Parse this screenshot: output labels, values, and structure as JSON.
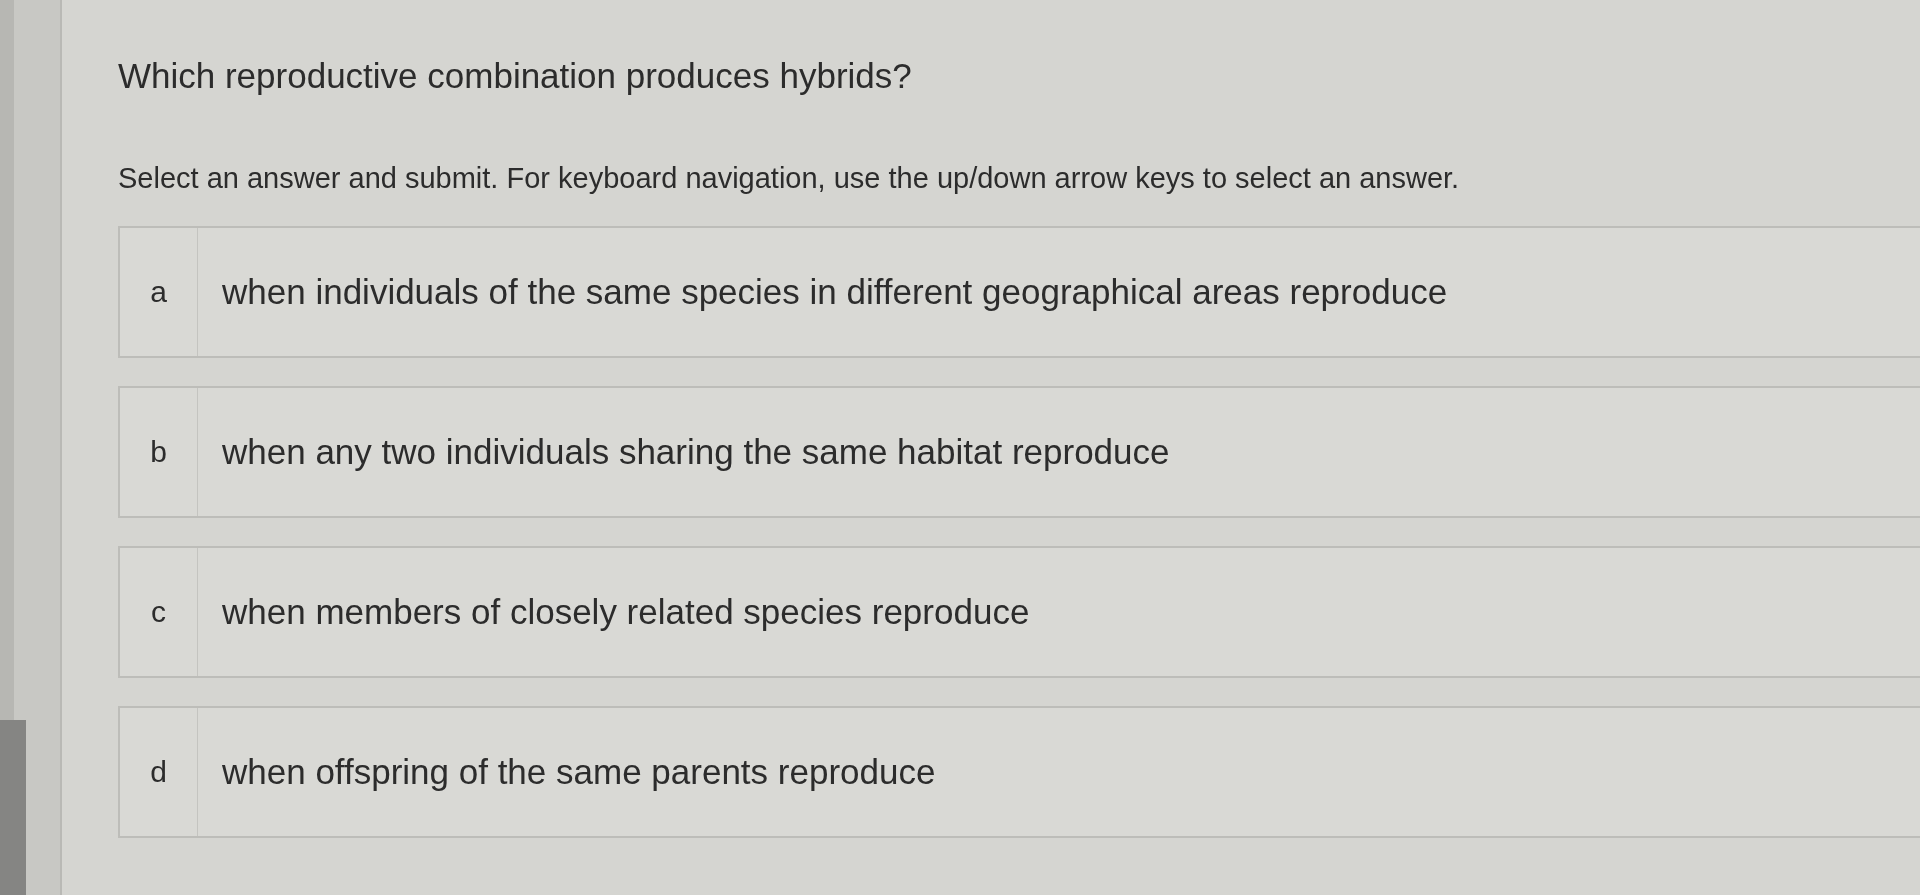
{
  "question": {
    "title": "Which reproductive combination produces hybrids?",
    "instructions": "Select an answer and submit. For keyboard navigation, use the up/down arrow keys to select an answer."
  },
  "options": [
    {
      "letter": "a",
      "text": "when individuals of the same species in different geographical areas reproduce",
      "selected": false
    },
    {
      "letter": "b",
      "text": "when any two individuals sharing the same habitat reproduce",
      "selected": false
    },
    {
      "letter": "c",
      "text": "when members of closely related species reproduce",
      "selected": false
    },
    {
      "letter": "d",
      "text": "when offspring of the same parents reproduce",
      "selected": false
    }
  ]
}
